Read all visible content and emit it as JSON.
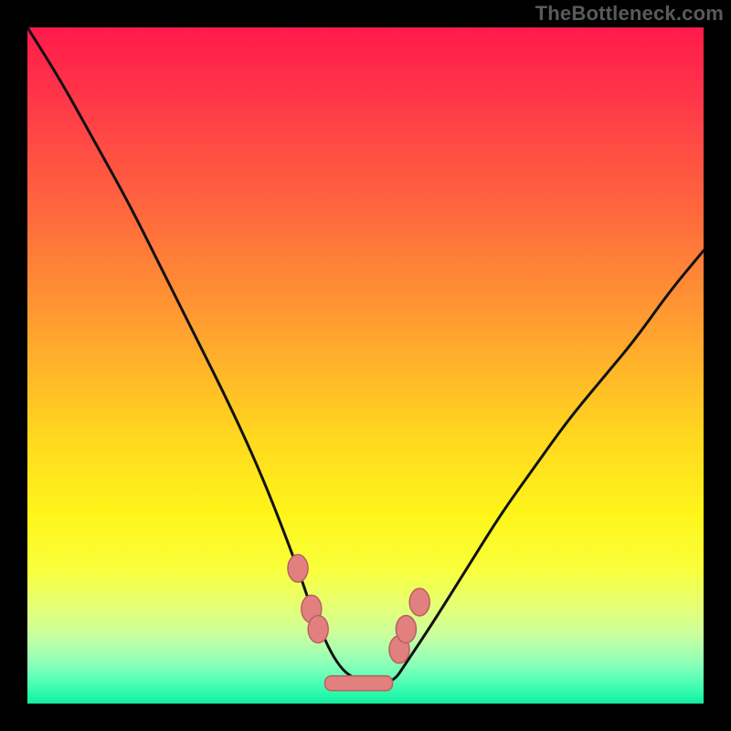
{
  "watermark": "TheBottleneck.com",
  "chart_data": {
    "type": "line",
    "title": "",
    "xlabel": "",
    "ylabel": "",
    "xlim": [
      0,
      100
    ],
    "ylim": [
      0,
      100
    ],
    "grid": false,
    "legend": false,
    "background_gradient": [
      "#ff1a4b",
      "#ffd61f",
      "#19e79c"
    ],
    "series": [
      {
        "name": "bottleneck-curve",
        "type": "line",
        "x": [
          0,
          5,
          10,
          15,
          20,
          25,
          30,
          35,
          40,
          42,
          46,
          50,
          54,
          56,
          60,
          65,
          70,
          75,
          80,
          85,
          90,
          95,
          100
        ],
        "y": [
          100,
          92,
          83,
          74,
          64,
          54,
          44,
          33,
          20,
          14,
          5,
          3,
          3,
          6,
          12,
          20,
          28,
          35,
          42,
          48,
          54,
          61,
          67
        ]
      }
    ],
    "annotations": {
      "soft_dots": {
        "description": "salmon markers near curve trough",
        "points": [
          {
            "x": 40,
            "y": 20
          },
          {
            "x": 42,
            "y": 14
          },
          {
            "x": 43,
            "y": 11
          },
          {
            "x": 55,
            "y": 8
          },
          {
            "x": 56,
            "y": 11
          },
          {
            "x": 58,
            "y": 15
          }
        ]
      },
      "flat_bar": {
        "description": "salmon rounded bar at trough",
        "x_start": 44,
        "x_end": 54,
        "y": 3
      }
    }
  }
}
